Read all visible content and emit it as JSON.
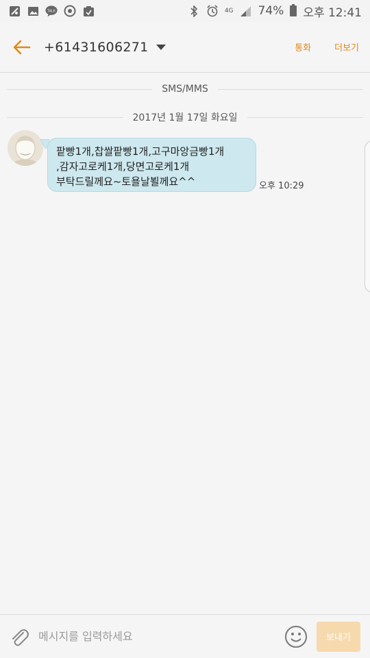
{
  "status_bar": {
    "icons_left": [
      "maps-icon",
      "image-icon",
      "talk-icon",
      "sync-icon",
      "clipboard-icon"
    ],
    "talk_badge": "TALK",
    "network": "4G",
    "battery": "74%",
    "time": "오후 12:41"
  },
  "header": {
    "contact": "+61431606271",
    "call_label": "통화",
    "more_label": "더보기"
  },
  "conversation": {
    "channel_label": "SMS/MMS",
    "date_label": "2017년 1월 17일 화요일",
    "messages": [
      {
        "lines": [
          "팥빵1개,찹쌀팥빵1개,고구마앙금빵1개",
          ",감자고로케1개,당면고로케1개",
          "부탁드릴께요~토욜날뵐께요^^"
        ],
        "time": "오후 10:29"
      }
    ]
  },
  "compose": {
    "placeholder": "메시지를 입력하세요",
    "send_label": "보내기"
  },
  "colors": {
    "accent": "#e0891a",
    "bubble": "#cde8ee",
    "send_disabled": "#f6d9ad"
  }
}
